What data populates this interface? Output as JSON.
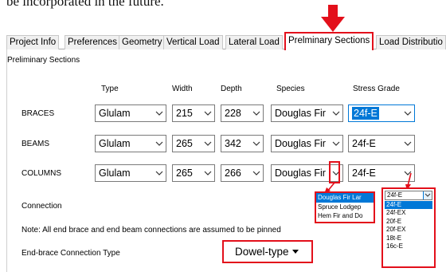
{
  "document": {
    "partial_text": "be incorporated in the future."
  },
  "tabs": [
    {
      "label": "Project Info"
    },
    {
      "label": "Preferences"
    },
    {
      "label": "Geometry"
    },
    {
      "label": "Vertical Load"
    },
    {
      "label": "Lateral Load"
    },
    {
      "label": "Prelminary Sections",
      "active": true
    },
    {
      "label": "Load Distributio"
    }
  ],
  "panel": {
    "title": "Preliminary Sections",
    "columns": {
      "type": "Type",
      "width": "Width",
      "depth": "Depth",
      "species": "Species",
      "stress_grade": "Stress Grade"
    },
    "rows": {
      "braces": {
        "label": "BRACES",
        "type": "Glulam",
        "width": "215",
        "depth": "228",
        "species": "Douglas Fir",
        "grade": "24f-E"
      },
      "beams": {
        "label": "BEAMS",
        "type": "Glulam",
        "width": "265",
        "depth": "342",
        "species": "Douglas Fir",
        "grade": "24f-E"
      },
      "columns": {
        "label": "COLUMNS",
        "type": "Glulam",
        "width": "265",
        "depth": "266",
        "species": "Douglas Fir",
        "grade": "24f-E"
      }
    },
    "connection_label": "Connection",
    "species_dropdown": {
      "options": [
        "Douglas Fir Lar",
        "Spruce Lodgep",
        "Hem Fir and Do"
      ],
      "selected_index": 0
    },
    "grade_dropdown": {
      "current": "24f-E",
      "options": [
        "24f-E",
        "24f-EX",
        "20f-E",
        "20f-EX",
        "18t-E",
        "16c-E"
      ],
      "selected_index": 0
    },
    "note": "Note: All end brace and end beam connections are assumed to be pinned",
    "end_brace_label": "End-brace Connection Type",
    "end_brace_value": "Dowel-type"
  },
  "colors": {
    "highlight_red": "#e3101b",
    "selection_blue": "#0078d7"
  }
}
